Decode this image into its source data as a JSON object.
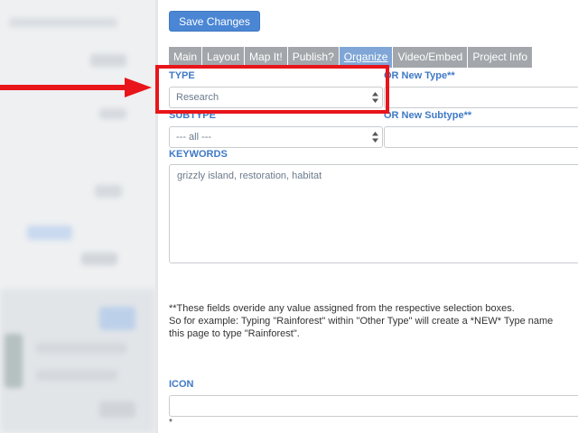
{
  "toolbar": {
    "save_label": "Save Changes"
  },
  "tabs": [
    {
      "label": "Main",
      "active": false
    },
    {
      "label": "Layout",
      "active": false
    },
    {
      "label": "Map It!",
      "active": false
    },
    {
      "label": "Publish?",
      "active": false
    },
    {
      "label": "Organize",
      "active": true
    },
    {
      "label": "Video/Embed",
      "active": false
    },
    {
      "label": "Project Info",
      "active": false
    }
  ],
  "form": {
    "type_label": "TYPE",
    "type_value": "Research",
    "new_type_label": "OR New Type**",
    "subtype_label": "SUBTYPE",
    "subtype_value": "--- all ---",
    "new_subtype_label": "OR New Subtype**",
    "keywords_label": "KEYWORDS",
    "keywords_value": "grizzly island, restoration, habitat",
    "icon_label": "ICON",
    "asterisk": "*"
  },
  "note": {
    "line1": "**These fields overide any value assigned from the respective selection boxes.",
    "line2": "So for example: Typing \"Rainforest\" within \"Other Type\" will create a *NEW* Type name",
    "line3": "this page to type \"Rainforest\"."
  },
  "colors": {
    "accent": "#4a86d4",
    "label": "#3f79c6",
    "annotation": "#e8151a",
    "tab_inactive": "#a3a7ab",
    "tab_active": "#7fa6d6"
  }
}
